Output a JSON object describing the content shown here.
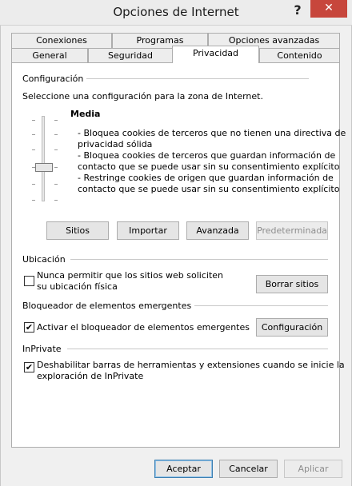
{
  "window": {
    "title": "Opciones de Internet",
    "help_glyph": "?",
    "close_glyph": "✕"
  },
  "tabs_row1": [
    {
      "label": "Conexiones"
    },
    {
      "label": "Programas"
    },
    {
      "label": "Opciones avanzadas"
    }
  ],
  "tabs_row2": [
    {
      "label": "General"
    },
    {
      "label": "Seguridad"
    },
    {
      "label": "Privacidad",
      "active": true
    },
    {
      "label": "Contenido"
    }
  ],
  "config": {
    "group_label": "Configuración",
    "instruction": "Seleccione una configuración para la zona de Internet.",
    "level_name": "Media",
    "slider_level_fraction": 0.6,
    "descriptions": [
      "- Bloquea cookies de terceros que no tienen una directiva de",
      "privacidad sólida",
      "- Bloquea cookies de terceros que guardan información de",
      "contacto que se puede usar sin su consentimiento explícito",
      "- Restringe cookies de origen que guardan información de",
      "contacto que se puede usar sin su consentimiento explícito"
    ],
    "buttons": {
      "sitios": "Sitios",
      "importar": "Importar",
      "avanzada": "Avanzada",
      "predeterminada": "Predeterminada"
    }
  },
  "location": {
    "group_label": "Ubicación",
    "checkbox_line1": "Nunca permitir que los sitios web soliciten",
    "checkbox_line2": "su ubicación física",
    "checked": false,
    "clear_button": "Borrar sitios"
  },
  "popup": {
    "group_label": "Bloqueador de elementos emergentes",
    "checkbox_label": "Activar el bloqueador de elementos emergentes",
    "checked": true,
    "check_glyph": "✔",
    "config_button": "Configuración"
  },
  "inprivate": {
    "group_label": "InPrivate",
    "checkbox_line1": "Deshabilitar barras de herramientas y extensiones cuando se inicie la",
    "checkbox_line2": "exploración de InPrivate",
    "checked": true,
    "check_glyph": "✔"
  },
  "footer": {
    "accept": "Aceptar",
    "cancel": "Cancelar",
    "apply": "Aplicar"
  },
  "colors": {
    "close_button": "#c7463c",
    "default_button_border": "#3c7fb1"
  }
}
